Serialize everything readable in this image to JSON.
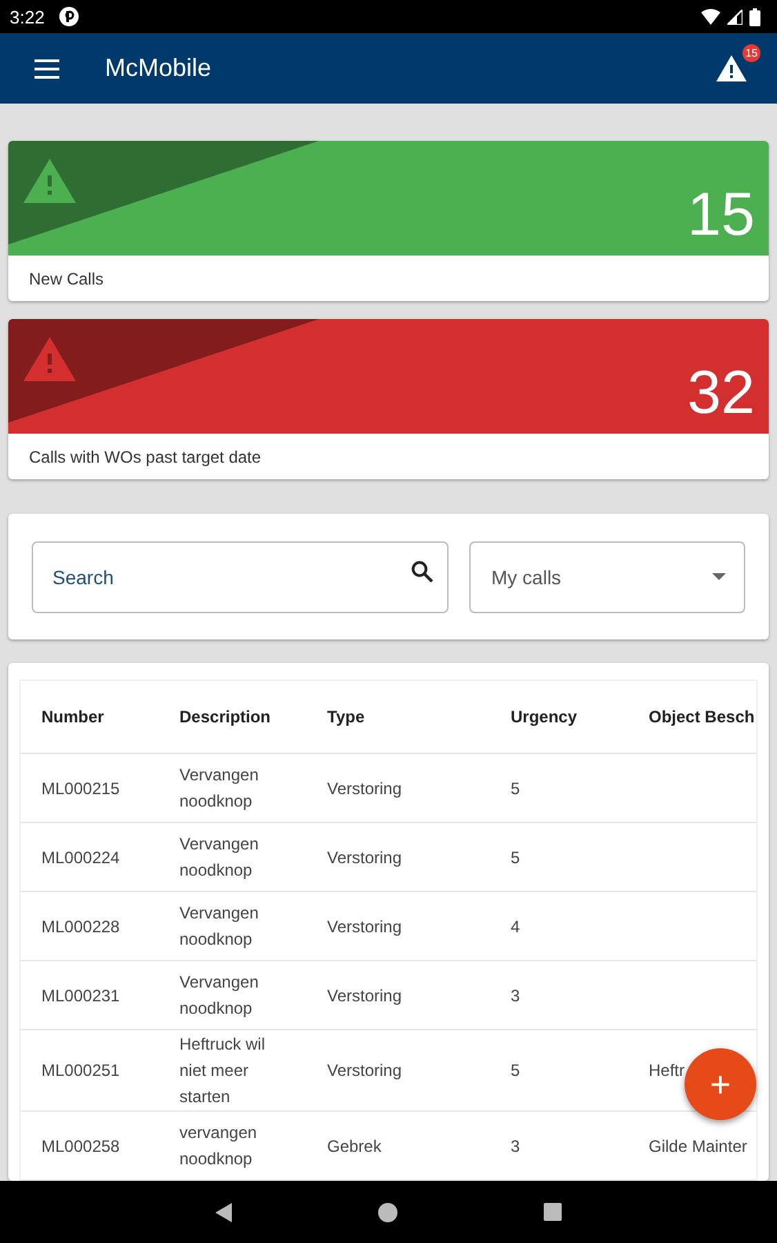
{
  "status_bar": {
    "time": "3:22"
  },
  "app_bar": {
    "title": "McMobile",
    "alert_count": "15"
  },
  "summary_cards": [
    {
      "count": "15",
      "label": "New Calls",
      "color": "#4caf50"
    },
    {
      "count": "32",
      "label": "Calls with WOs past target date",
      "color": "#d32f2f"
    }
  ],
  "filters": {
    "search": {
      "placeholder": "Search"
    },
    "dropdown": {
      "value": "My calls"
    }
  },
  "table": {
    "columns": [
      "Number",
      "Description",
      "Type",
      "Urgency",
      "Object Besch"
    ],
    "rows": [
      [
        "ML000215",
        "Vervangen noodknop",
        "Verstoring",
        "5",
        ""
      ],
      [
        "ML000224",
        "Vervangen noodknop",
        "Verstoring",
        "5",
        ""
      ],
      [
        "ML000228",
        "Vervangen noodknop",
        "Verstoring",
        "4",
        ""
      ],
      [
        "ML000231",
        "Vervangen noodknop",
        "Verstoring",
        "3",
        ""
      ],
      [
        "ML000251",
        "Heftruck wil niet meer starten",
        "Verstoring",
        "5",
        "Heftr"
      ],
      [
        "ML000258",
        "vervangen noodknop",
        "Gebrek",
        "3",
        "Gilde Mainter"
      ]
    ]
  },
  "fab": {
    "label": "+"
  }
}
